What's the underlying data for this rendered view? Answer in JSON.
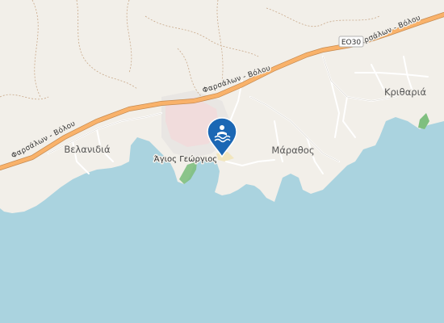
{
  "map": {
    "labels": {
      "velanidia": "Βελανιδιά",
      "agios_georgios": "Άγιος Γεώργιος",
      "marathos": "Μάραθος",
      "krivaria": "Κριθαριά"
    },
    "roads": {
      "highway_name_west": "Φαρσάλων - Βόλου",
      "highway_name_middle": "Φαρσάλων - Βόλου",
      "highway_name_east": "Φαρσάλων - Βόλου",
      "route_ref": "ΕΟ30"
    },
    "marker": {
      "icon": "swimming-icon",
      "color": "#1b67b4"
    },
    "colors": {
      "sea": "#aad3df",
      "land": "#f2efe9",
      "highway": "#f9b26a",
      "residential": "#e0dfdf",
      "park": "#7fbf7f"
    }
  }
}
